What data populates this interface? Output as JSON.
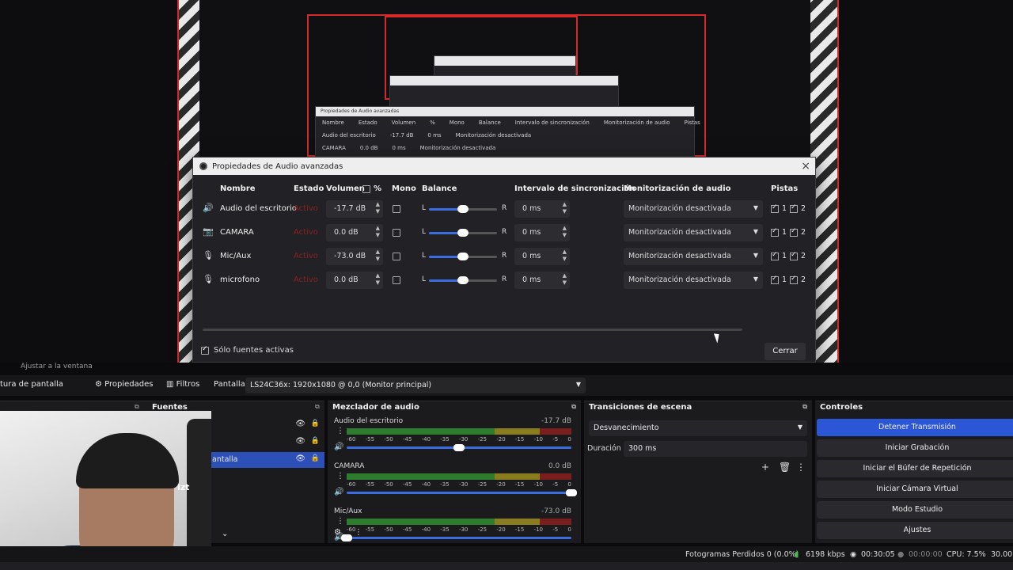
{
  "preview": {
    "fit_label": "Ajustar a la ventana",
    "mini_dialogs": [
      {
        "title": "Propiedades de Audio avanzadas",
        "headers": [
          "Nombre",
          "Estado",
          "Volumen",
          "%",
          "Mono",
          "Balance",
          "Intervalo de sincronización",
          "Monitorización de audio",
          "Pistas"
        ],
        "rows": [
          [
            "Audio del escritorio",
            "-17.7 dB",
            "0 ms",
            "Monitorización desactivada"
          ],
          [
            "CAMARA",
            "0.0 dB",
            "0 ms",
            "Monitorización desactivada"
          ]
        ]
      }
    ]
  },
  "dialog": {
    "title": "Propiedades de Audio avanzadas",
    "close_icon": "×",
    "headers": {
      "name": "Nombre",
      "state": "Estado",
      "volume": "Volumen",
      "percent": "%",
      "mono": "Mono",
      "balance": "Balance",
      "sync": "Intervalo de sincronización",
      "monitoring": "Monitorización de audio",
      "tracks": "Pistas"
    },
    "rows": [
      {
        "icon": "speaker-icon",
        "glyph": "🔊",
        "name": "Audio del escritorio",
        "state": "Activo",
        "volume": "-17.7 dB",
        "balance_l": "L",
        "balance_r": "R",
        "balance": 0.5,
        "sync": "0 ms",
        "monitoring": "Monitorización desactivada",
        "track1": "1",
        "track2": "2"
      },
      {
        "icon": "camera-icon",
        "glyph": "📷",
        "name": "CAMARA",
        "state": "Activo",
        "volume": "0.0 dB",
        "balance_l": "L",
        "balance_r": "R",
        "balance": 0.5,
        "sync": "0 ms",
        "monitoring": "Monitorización desactivada",
        "track1": "1",
        "track2": "2"
      },
      {
        "icon": "microphone-icon",
        "glyph": "🎙",
        "name": "Mic/Aux",
        "state": "Activo",
        "volume": "-73.0 dB",
        "balance_l": "L",
        "balance_r": "R",
        "balance": 0.5,
        "sync": "0 ms",
        "monitoring": "Monitorización desactivada",
        "track1": "1",
        "track2": "2"
      },
      {
        "icon": "microphone-icon",
        "glyph": "🎙",
        "name": "microfono",
        "state": "Activo",
        "volume": "0.0 dB",
        "balance_l": "L",
        "balance_r": "R",
        "balance": 0.5,
        "sync": "0 ms",
        "monitoring": "Monitorización desactivada",
        "track1": "1",
        "track2": "2"
      }
    ],
    "only_active_label": "Sólo fuentes activas",
    "close_button": "Cerrar"
  },
  "toolbar": {
    "scene_partial": "tura de pantalla",
    "properties": "Propiedades",
    "filters": "Filtros",
    "display_label": "Pantalla",
    "display_value": "LS24C36x: 1920x1080 @ 0,0 (Monitor principal)"
  },
  "sources": {
    "title": "Fuentes",
    "items": [
      {
        "name": "",
        "selected": false
      },
      {
        "name": "",
        "selected": false
      },
      {
        "name": "antalla",
        "selected": true
      }
    ],
    "webcam_text": "izt"
  },
  "mixer": {
    "title": "Mezclador de audio",
    "ticks": [
      "-60",
      "-55",
      "-50",
      "-45",
      "-40",
      "-35",
      "-30",
      "-25",
      "-20",
      "-15",
      "-10",
      "-5",
      "0"
    ],
    "channels": [
      {
        "name": "Audio del escritorio",
        "db": "-17.7 dB",
        "volume": 0.5
      },
      {
        "name": "CAMARA",
        "db": "0.0 dB",
        "volume": 1.0
      },
      {
        "name": "Mic/Aux",
        "db": "-73.0 dB",
        "volume": 0.0
      }
    ]
  },
  "transitions": {
    "title": "Transiciones de escena",
    "selected": "Desvanecimiento",
    "duration_label": "Duración",
    "duration_value": "300 ms"
  },
  "controls": {
    "title": "Controles",
    "buttons": [
      "Detener Transmisión",
      "Iniciar Grabación",
      "Iniciar el Búfer de Repetición",
      "Iniciar Cámara Virtual",
      "Modo Estudio",
      "Ajustes"
    ]
  },
  "status": {
    "dropped": "Fotogramas Perdidos 0 (0.0%)",
    "kbps": "6198 kbps",
    "stream_time": "00:30:05",
    "rec_time": "00:00:00",
    "cpu": "CPU: 7.5%",
    "fps": "30.00"
  },
  "colors": {
    "accent": "#2b56d6",
    "inactive_state": "#8a2020",
    "preview_border": "#d42a2a"
  }
}
